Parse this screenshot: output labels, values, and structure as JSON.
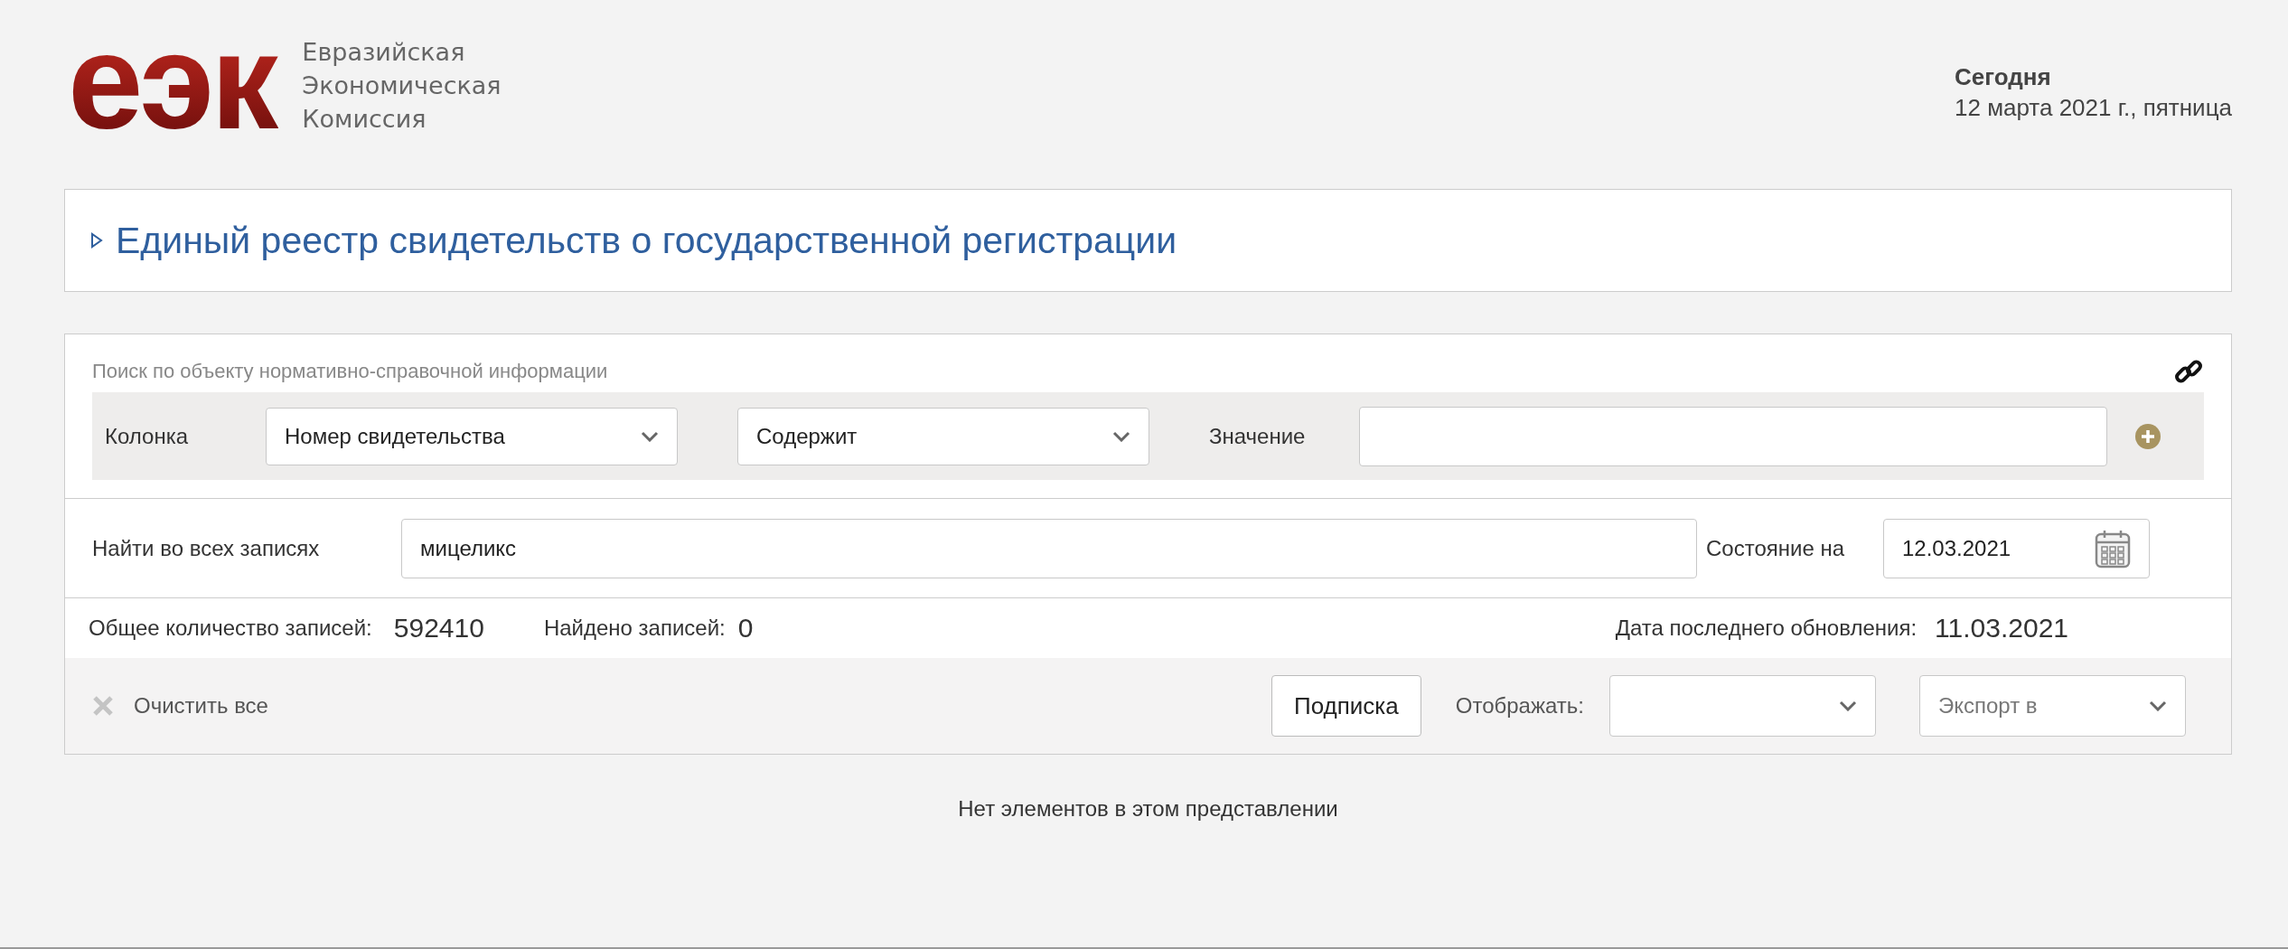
{
  "logo": {
    "mark": "еэк",
    "lines": [
      "Евразийская",
      "Экономическая",
      "Комиссия"
    ]
  },
  "today": {
    "label": "Сегодня",
    "date": "12 марта 2021 г., пятница"
  },
  "registry": {
    "title": "Единый реестр свидетельств о государственной регистрации",
    "expanded": false
  },
  "search": {
    "caption": "Поиск по объекту нормативно-справочной информации",
    "filter": {
      "column_label": "Колонка",
      "column_select": "Номер свидетельства",
      "condition_select": "Содержит",
      "value_label": "Значение"
    },
    "find_all": {
      "label": "Найти во всех записях",
      "value": "мицеликс"
    },
    "state_on": {
      "label": "Состояние на",
      "value": "12.03.2021"
    }
  },
  "stats": {
    "total_label": "Общее количество записей:",
    "total": "592410",
    "found_label": "Найдено записей:",
    "found": "0",
    "updated_label": "Дата последнего обновления:",
    "updated": "11.03.2021"
  },
  "toolbar": {
    "clear_label": "Очистить все",
    "subscribe_button": "Подписка",
    "display_label": "Отображать:",
    "export_placeholder": "Экспорт в"
  },
  "empty_message": "Нет элементов в этом представлении"
}
